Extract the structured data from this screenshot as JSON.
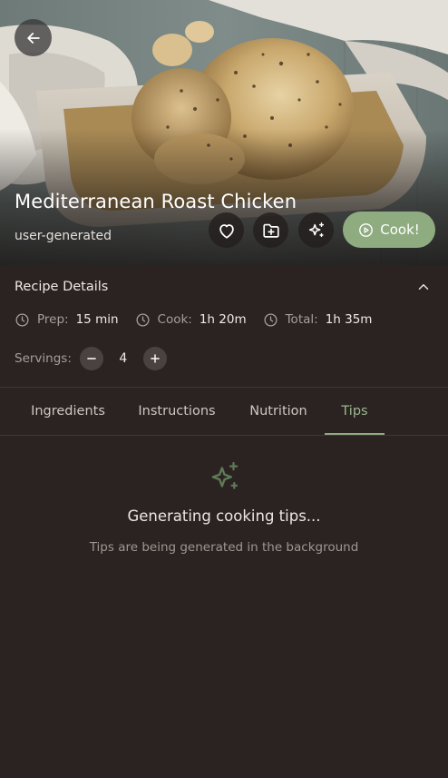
{
  "hero": {
    "title": "Mediterranean Roast Chicken",
    "source": "user-generated",
    "image_alt": "roast-chicken-photo"
  },
  "actions": {
    "back_icon": "arrow-left-icon",
    "favorite_icon": "heart-icon",
    "save_icon": "folder-plus-icon",
    "ai_icon": "sparkles-icon",
    "cook_label": "Cook!",
    "cook_icon": "play-circle-icon"
  },
  "details": {
    "title": "Recipe Details",
    "collapse_icon": "chevron-up-icon",
    "prep_label": "Prep:",
    "prep_value": "15 min",
    "cook_label": "Cook:",
    "cook_value": "1h 20m",
    "total_label": "Total:",
    "total_value": "1h 35m",
    "servings_label": "Servings:",
    "servings_value": "4"
  },
  "tabs": [
    {
      "label": "Ingredients",
      "active": false
    },
    {
      "label": "Instructions",
      "active": false
    },
    {
      "label": "Nutrition",
      "active": false
    },
    {
      "label": "Tips",
      "active": true
    }
  ],
  "tips": {
    "heading": "Generating cooking tips...",
    "subtext": "Tips are being generated in the background"
  },
  "colors": {
    "background": "#2b2321",
    "accent": "#8fac81",
    "accent_text": "#9cb88f",
    "muted_text": "#a69e99"
  }
}
